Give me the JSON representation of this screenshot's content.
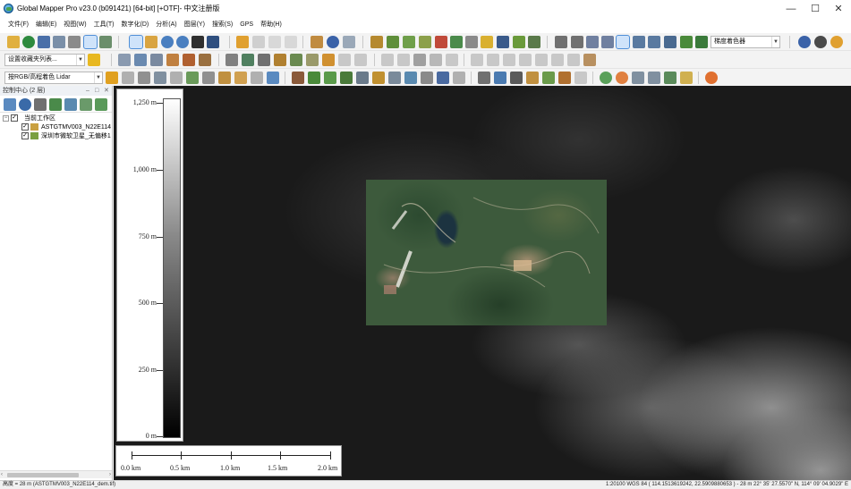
{
  "window": {
    "title": "Global Mapper Pro v23.0 (b091421) [64-bit] [+OTF]- 中文注册版"
  },
  "menu": [
    "文件(F)",
    "编辑(E)",
    "视图(W)",
    "工具(T)",
    "数字化(D)",
    "分析(A)",
    "图层(Y)",
    "搜索(S)",
    "GPS",
    "帮助(H)"
  ],
  "toolbar": {
    "shader_combo": "梯度着色器",
    "favorites_combo": "设置收藏夹列表...",
    "lidar_combo": "按RGB/高程着色 Lidar"
  },
  "control_center": {
    "title": "控制中心 (2 层)",
    "workspace": "当前工作区",
    "layers": [
      {
        "name": "ASTGTMV003_N22E114",
        "checked": true
      },
      {
        "name": "深圳市微软卫星_无偏移1",
        "checked": true
      }
    ]
  },
  "legend": {
    "elevation_labels": [
      "1,250 m",
      "1,000 m",
      "750 m",
      "500 m",
      "250 m",
      "0 m"
    ],
    "scale_labels": [
      "0.0 km",
      "0.5 km",
      "1.0 km",
      "1.5 km",
      "2.0 km"
    ]
  },
  "status": {
    "left": "高度 = 28 m (ASTGTMV003_N22E114_dem.tif)",
    "right": "1:20100  WGS 84 ( 114.1513619242, 22.5909880653 ) - 28 m  22° 35' 27.5570\" N, 114° 09' 04.9029\" E"
  },
  "colors": {
    "accent": "#4f8fd8",
    "selected_bg": "#cfe3fa",
    "map_bg": "#1a1a1a"
  }
}
